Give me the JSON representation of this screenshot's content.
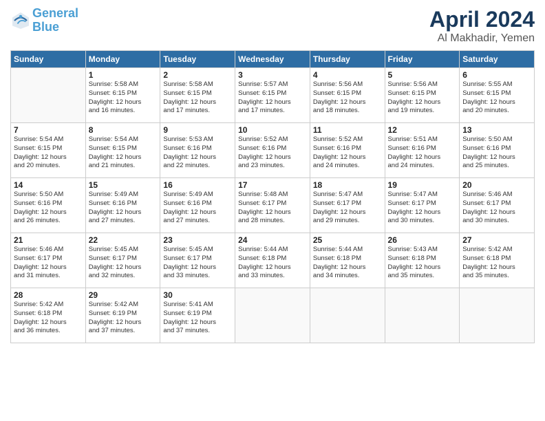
{
  "logo": {
    "line1": "General",
    "line2": "Blue"
  },
  "title": "April 2024",
  "subtitle": "Al Makhadir, Yemen",
  "days_of_week": [
    "Sunday",
    "Monday",
    "Tuesday",
    "Wednesday",
    "Thursday",
    "Friday",
    "Saturday"
  ],
  "weeks": [
    [
      {
        "day": "",
        "info": ""
      },
      {
        "day": "1",
        "info": "Sunrise: 5:58 AM\nSunset: 6:15 PM\nDaylight: 12 hours\nand 16 minutes."
      },
      {
        "day": "2",
        "info": "Sunrise: 5:58 AM\nSunset: 6:15 PM\nDaylight: 12 hours\nand 17 minutes."
      },
      {
        "day": "3",
        "info": "Sunrise: 5:57 AM\nSunset: 6:15 PM\nDaylight: 12 hours\nand 17 minutes."
      },
      {
        "day": "4",
        "info": "Sunrise: 5:56 AM\nSunset: 6:15 PM\nDaylight: 12 hours\nand 18 minutes."
      },
      {
        "day": "5",
        "info": "Sunrise: 5:56 AM\nSunset: 6:15 PM\nDaylight: 12 hours\nand 19 minutes."
      },
      {
        "day": "6",
        "info": "Sunrise: 5:55 AM\nSunset: 6:15 PM\nDaylight: 12 hours\nand 20 minutes."
      }
    ],
    [
      {
        "day": "7",
        "info": "Sunrise: 5:54 AM\nSunset: 6:15 PM\nDaylight: 12 hours\nand 20 minutes."
      },
      {
        "day": "8",
        "info": "Sunrise: 5:54 AM\nSunset: 6:15 PM\nDaylight: 12 hours\nand 21 minutes."
      },
      {
        "day": "9",
        "info": "Sunrise: 5:53 AM\nSunset: 6:16 PM\nDaylight: 12 hours\nand 22 minutes."
      },
      {
        "day": "10",
        "info": "Sunrise: 5:52 AM\nSunset: 6:16 PM\nDaylight: 12 hours\nand 23 minutes."
      },
      {
        "day": "11",
        "info": "Sunrise: 5:52 AM\nSunset: 6:16 PM\nDaylight: 12 hours\nand 24 minutes."
      },
      {
        "day": "12",
        "info": "Sunrise: 5:51 AM\nSunset: 6:16 PM\nDaylight: 12 hours\nand 24 minutes."
      },
      {
        "day": "13",
        "info": "Sunrise: 5:50 AM\nSunset: 6:16 PM\nDaylight: 12 hours\nand 25 minutes."
      }
    ],
    [
      {
        "day": "14",
        "info": "Sunrise: 5:50 AM\nSunset: 6:16 PM\nDaylight: 12 hours\nand 26 minutes."
      },
      {
        "day": "15",
        "info": "Sunrise: 5:49 AM\nSunset: 6:16 PM\nDaylight: 12 hours\nand 27 minutes."
      },
      {
        "day": "16",
        "info": "Sunrise: 5:49 AM\nSunset: 6:16 PM\nDaylight: 12 hours\nand 27 minutes."
      },
      {
        "day": "17",
        "info": "Sunrise: 5:48 AM\nSunset: 6:17 PM\nDaylight: 12 hours\nand 28 minutes."
      },
      {
        "day": "18",
        "info": "Sunrise: 5:47 AM\nSunset: 6:17 PM\nDaylight: 12 hours\nand 29 minutes."
      },
      {
        "day": "19",
        "info": "Sunrise: 5:47 AM\nSunset: 6:17 PM\nDaylight: 12 hours\nand 30 minutes."
      },
      {
        "day": "20",
        "info": "Sunrise: 5:46 AM\nSunset: 6:17 PM\nDaylight: 12 hours\nand 30 minutes."
      }
    ],
    [
      {
        "day": "21",
        "info": "Sunrise: 5:46 AM\nSunset: 6:17 PM\nDaylight: 12 hours\nand 31 minutes."
      },
      {
        "day": "22",
        "info": "Sunrise: 5:45 AM\nSunset: 6:17 PM\nDaylight: 12 hours\nand 32 minutes."
      },
      {
        "day": "23",
        "info": "Sunrise: 5:45 AM\nSunset: 6:17 PM\nDaylight: 12 hours\nand 33 minutes."
      },
      {
        "day": "24",
        "info": "Sunrise: 5:44 AM\nSunset: 6:18 PM\nDaylight: 12 hours\nand 33 minutes."
      },
      {
        "day": "25",
        "info": "Sunrise: 5:44 AM\nSunset: 6:18 PM\nDaylight: 12 hours\nand 34 minutes."
      },
      {
        "day": "26",
        "info": "Sunrise: 5:43 AM\nSunset: 6:18 PM\nDaylight: 12 hours\nand 35 minutes."
      },
      {
        "day": "27",
        "info": "Sunrise: 5:42 AM\nSunset: 6:18 PM\nDaylight: 12 hours\nand 35 minutes."
      }
    ],
    [
      {
        "day": "28",
        "info": "Sunrise: 5:42 AM\nSunset: 6:18 PM\nDaylight: 12 hours\nand 36 minutes."
      },
      {
        "day": "29",
        "info": "Sunrise: 5:42 AM\nSunset: 6:19 PM\nDaylight: 12 hours\nand 37 minutes."
      },
      {
        "day": "30",
        "info": "Sunrise: 5:41 AM\nSunset: 6:19 PM\nDaylight: 12 hours\nand 37 minutes."
      },
      {
        "day": "",
        "info": ""
      },
      {
        "day": "",
        "info": ""
      },
      {
        "day": "",
        "info": ""
      },
      {
        "day": "",
        "info": ""
      }
    ]
  ]
}
